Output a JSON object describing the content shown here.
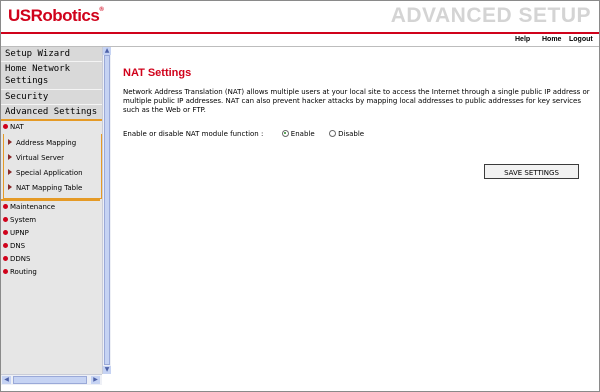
{
  "header": {
    "logo": "USRobotics",
    "logo_mark": "®",
    "title": "ADVANCED SETUP",
    "nav": [
      "Help",
      "Home",
      "Logout"
    ]
  },
  "sidebar": {
    "main_items": [
      "Setup Wizard",
      "Home Network Settings",
      "Security",
      "Advanced Settings"
    ],
    "active_section": "NAT",
    "nat_items": [
      "Address Mapping",
      "Virtual Server",
      "Special Application",
      "NAT Mapping Table"
    ],
    "other_items": [
      "Maintenance",
      "System",
      "UPNP",
      "DNS",
      "DDNS",
      "Routing"
    ]
  },
  "main": {
    "title": "NAT Settings",
    "description": "Network Address Translation (NAT) allows multiple users at your local site to access the Internet through a single public IP address or multiple public IP addresses. NAT can also prevent hacker attacks by mapping local addresses to public addresses for key services such as the Web or FTP.",
    "nat_label": "Enable or disable NAT module function :",
    "options": [
      "Enable",
      "Disable"
    ],
    "selected": "Enable",
    "save_label": "SAVE SETTINGS"
  },
  "colors": {
    "brand_red": "#d0021b",
    "accent_orange": "#e59a26",
    "sidebar_bg": "#e6e6e6"
  }
}
